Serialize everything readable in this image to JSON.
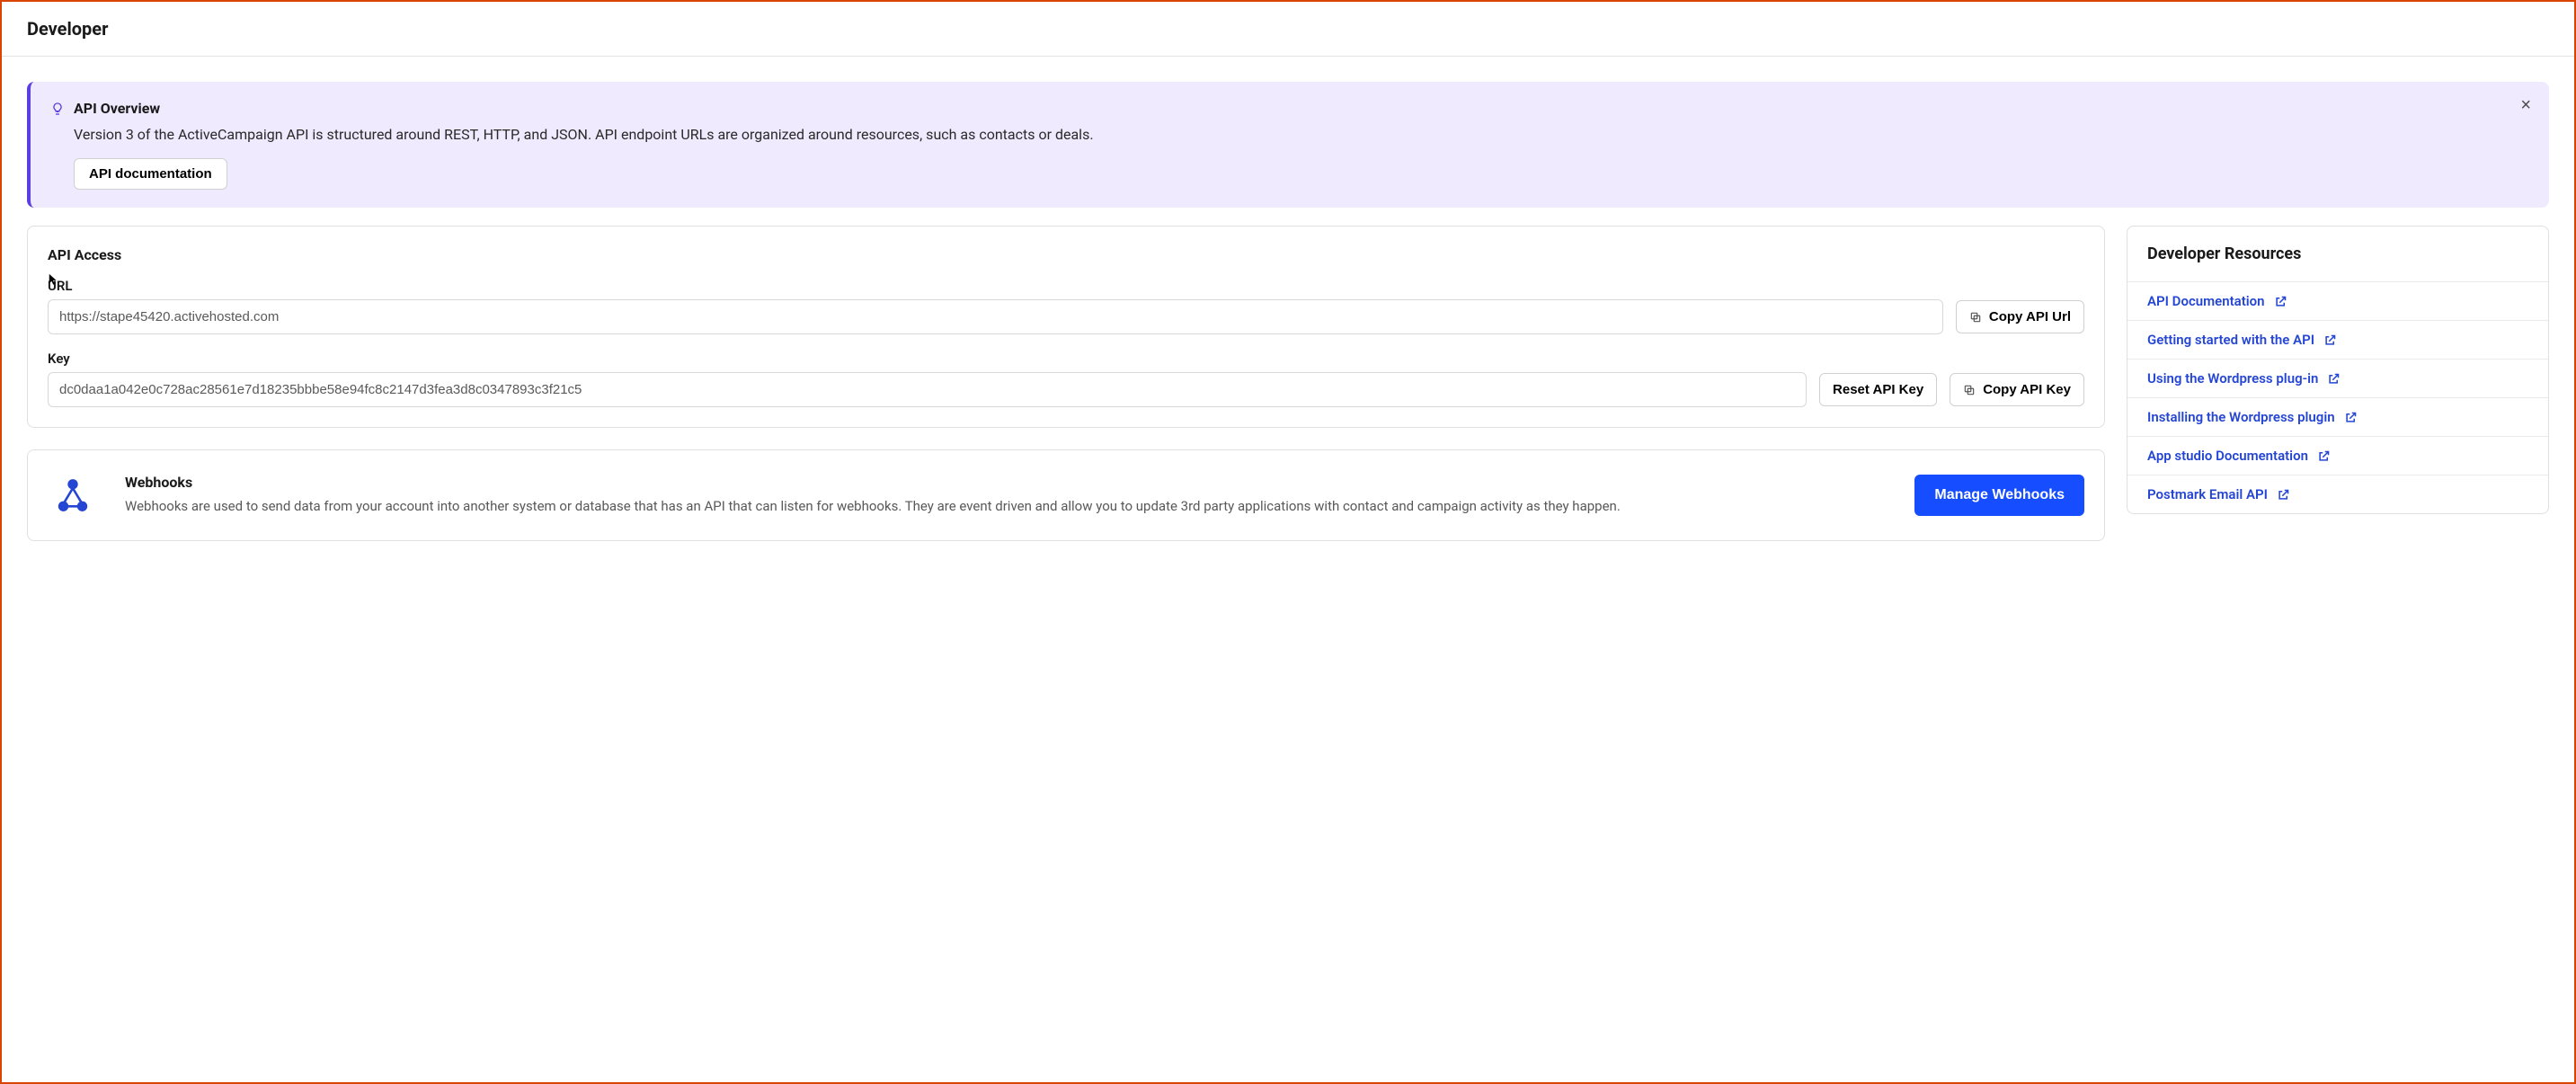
{
  "page_title": "Developer",
  "callout": {
    "title": "API Overview",
    "description": "Version 3 of the ActiveCampaign API is structured around REST, HTTP, and JSON. API endpoint URLs are organized around resources, such as contacts or deals.",
    "button": "API documentation"
  },
  "api_access": {
    "title": "API Access",
    "url_label": "URL",
    "url_value": "https://stape45420.activehosted.com",
    "key_label": "Key",
    "key_value": "dc0daa1a042e0c728ac28561e7d18235bbbe58e94fc8c2147d3fea3d8c0347893c3f21c5",
    "copy_url_btn": "Copy API Url",
    "reset_key_btn": "Reset API Key",
    "copy_key_btn": "Copy API Key"
  },
  "webhooks": {
    "title": "Webhooks",
    "description": "Webhooks are used to send data from your account into another system or database that has an API that can listen for webhooks. They are event driven and allow you to update 3rd party applications with contact and campaign activity as they happen.",
    "button": "Manage Webhooks"
  },
  "resources": {
    "title": "Developer Resources",
    "links": [
      "API Documentation",
      "Getting started with the API",
      "Using the Wordpress plug-in",
      "Installing the Wordpress plugin",
      "App studio Documentation",
      "Postmark Email API"
    ]
  },
  "icons": {
    "bulb": "lightbulb-icon",
    "close": "×",
    "copy": "copy-icon",
    "external": "external-link-icon",
    "webhook": "webhook-icon"
  },
  "colors": {
    "accent": "#5b3fe0",
    "primary_button": "#164dff",
    "link": "#2546d3",
    "border": "#d94500"
  }
}
